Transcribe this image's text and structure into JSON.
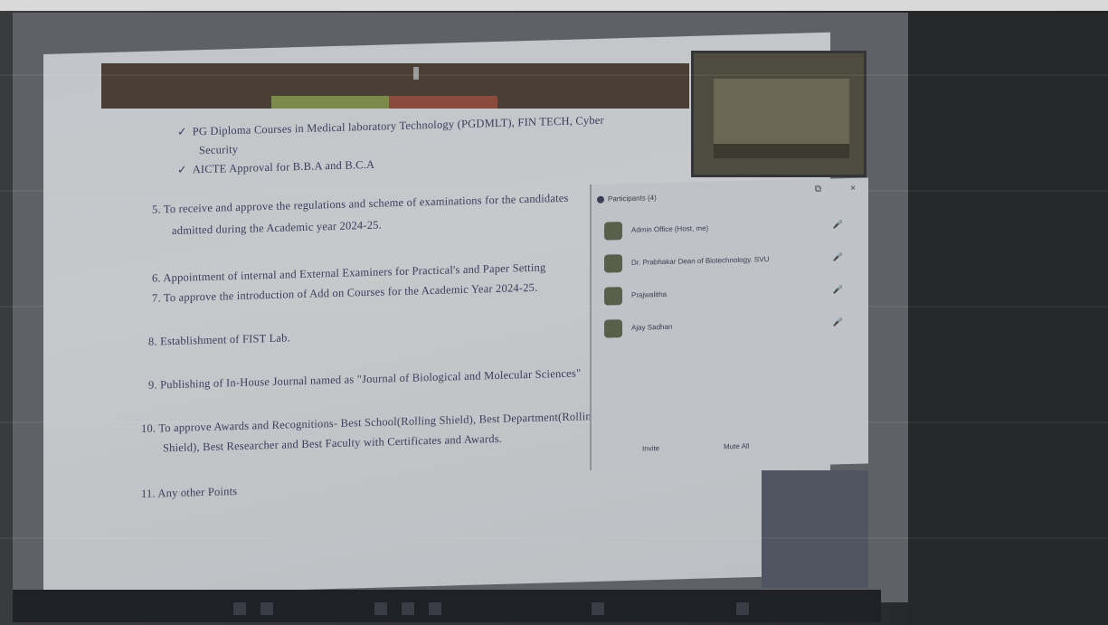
{
  "document": {
    "items": [
      {
        "marker": "✓",
        "text": "PG Diploma Courses in Medical laboratory Technology (PGDMLT), FIN TECH, Cyber"
      },
      {
        "marker": "",
        "text": "Security"
      },
      {
        "marker": "✓",
        "text": "AICTE Approval for B.B.A and B.C.A"
      },
      {
        "marker": "5.",
        "text": "To receive and approve the regulations and scheme of examinations for the candidates"
      },
      {
        "marker": "",
        "text": "admitted during the Academic year 2024-25."
      },
      {
        "marker": "6.",
        "text": "Appointment of internal and External Examiners for Practical's and Paper Setting"
      },
      {
        "marker": "7.",
        "text": "To approve the introduction of Add on Courses for the Academic Year 2024-25."
      },
      {
        "marker": "8.",
        "text": "Establishment of FIST Lab."
      },
      {
        "marker": "9.",
        "text": "Publishing of In-House Journal named as \"Journal of Biological and Molecular Sciences\""
      },
      {
        "marker": "10.",
        "text": "To approve Awards and Recognitions- Best School(Rolling Shield), Best Department(Rolling"
      },
      {
        "marker": "",
        "text": "Shield), Best Researcher and Best Faculty with Certificates and Awards."
      },
      {
        "marker": "11.",
        "text": "Any other Points"
      }
    ]
  },
  "participants_panel": {
    "title": "Participants (4)",
    "close": "×",
    "popout": "⧉",
    "participants": [
      {
        "name": "Admin Office (Host, me)",
        "status": "🎤"
      },
      {
        "name": "Dr. Prabhakar Dean of Biotechnology. SVU",
        "status": "🎤"
      },
      {
        "name": "Prajwalitha",
        "status": "🎤"
      },
      {
        "name": "Ajay Sadhan",
        "status": "🎤"
      }
    ],
    "invite_label": "Invite",
    "mute_all_label": "Mute All"
  },
  "colors": {
    "document_bg": "#c4c7cb",
    "toolbar_bg": "#4a3f35",
    "taskbar_bg": "#1f2126",
    "text_color": "#3a3e5c"
  }
}
